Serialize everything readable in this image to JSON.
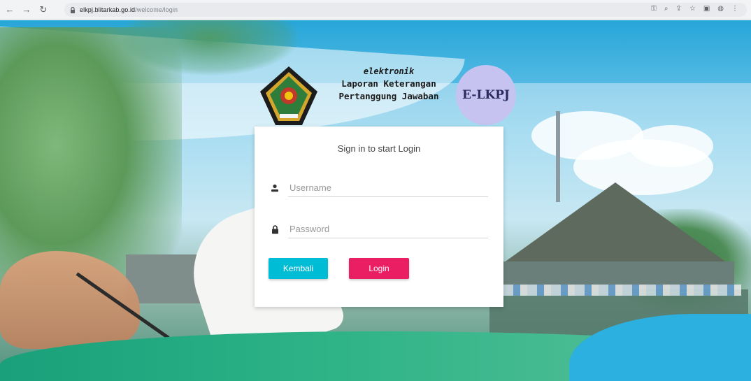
{
  "browser": {
    "url_host": "elkpj.blitarkab.go.id",
    "url_path": "/welcome/login"
  },
  "header": {
    "line1": "elektronik",
    "line2": "Laporan Keterangan",
    "line3": "Pertanggung Jawaban",
    "badge": "E-LKPJ"
  },
  "login": {
    "title": "Sign in to start Login",
    "username_placeholder": "Username",
    "password_placeholder": "Password",
    "back_label": "Kembali",
    "login_label": "Login"
  },
  "colors": {
    "back_button": "#00bcd4",
    "login_button": "#e91e63",
    "badge": "#c6c3f1"
  }
}
